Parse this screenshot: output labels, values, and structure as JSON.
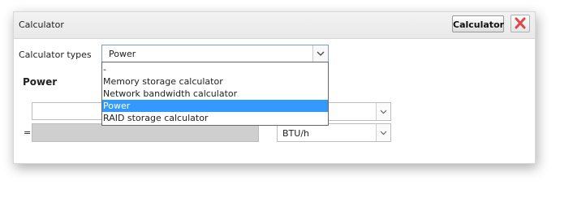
{
  "dialog": {
    "title": "Calculator",
    "title_button_label": "Calculator"
  },
  "form": {
    "calculator_types_label": "Calculator types",
    "calculator_types_value": "Power",
    "dropdown_options": [
      "-",
      "Memory storage calculator",
      "Network bandwidth calculator",
      "Power",
      "RAID storage calculator"
    ],
    "selected_option": "Power",
    "section_title": "Power",
    "result_prefix": "=",
    "result_unit": "BTU/h"
  },
  "colors": {
    "close_icon": "#e04848",
    "highlight": "#3399ff"
  }
}
